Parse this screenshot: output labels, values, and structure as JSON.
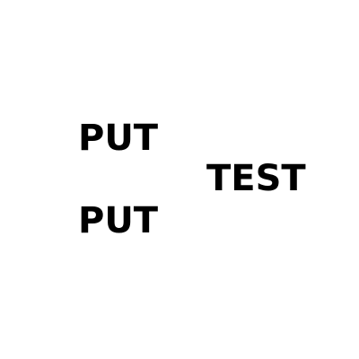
{
  "words": {
    "first": "PUT",
    "second": "TEST",
    "third": "PUT"
  },
  "colors": {
    "background": "#ffffff",
    "text": "#000000"
  }
}
